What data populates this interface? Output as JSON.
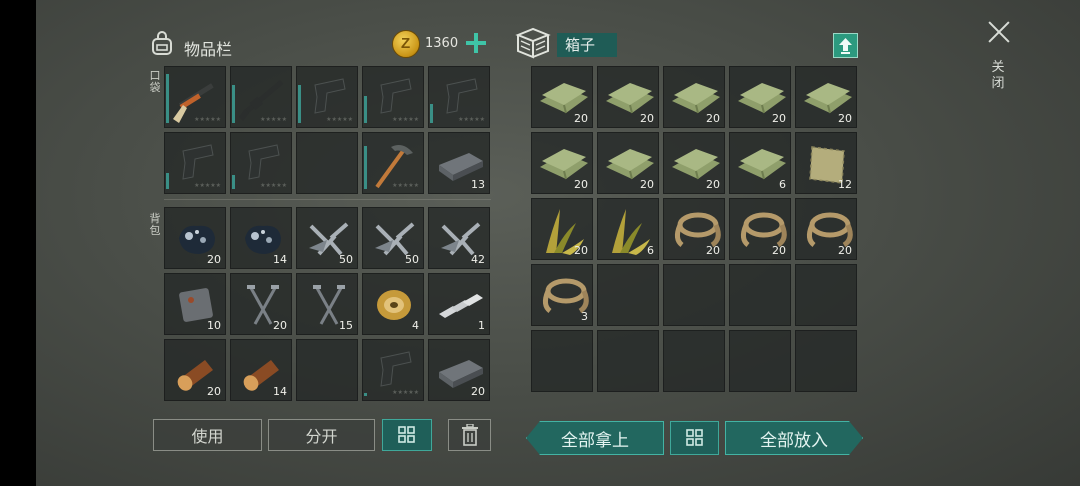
{
  "inventory": {
    "title": "物品栏",
    "coins": "1360",
    "pocket_label": "口袋",
    "backpack_label": "背包"
  },
  "pocket": [
    {
      "icon": "shotgun-icon",
      "count": "",
      "durability": 0.9
    },
    {
      "icon": "assault-rifle-icon",
      "count": "",
      "durability": 0.7
    },
    {
      "icon": "pistol-icon",
      "count": "",
      "durability": 0.7
    },
    {
      "icon": "pistol-icon",
      "count": "",
      "durability": 0.5
    },
    {
      "icon": "pistol-icon",
      "count": "",
      "durability": 0.35
    },
    {
      "icon": "pistol-icon",
      "count": "",
      "durability": 0.3
    },
    {
      "icon": "pistol-icon",
      "count": "",
      "durability": 0.25
    },
    {
      "icon": "empty",
      "count": ""
    },
    {
      "icon": "pickaxe-icon",
      "count": "",
      "durability": 0.8
    },
    {
      "icon": "iron-bar-icon",
      "count": "13"
    }
  ],
  "backpack": [
    {
      "icon": "iron-ore-icon",
      "count": "20"
    },
    {
      "icon": "iron-ore-icon",
      "count": "14"
    },
    {
      "icon": "metal-parts-icon",
      "count": "50"
    },
    {
      "icon": "metal-parts-icon",
      "count": "50"
    },
    {
      "icon": "metal-parts-icon",
      "count": "42"
    },
    {
      "icon": "metal-plate-icon",
      "count": "10"
    },
    {
      "icon": "nails-icon",
      "count": "20"
    },
    {
      "icon": "nails-icon",
      "count": "15"
    },
    {
      "icon": "wire-spool-icon",
      "count": "4"
    },
    {
      "icon": "aluminum-bar-icon",
      "count": "1"
    },
    {
      "icon": "log-icon",
      "count": "20"
    },
    {
      "icon": "log-icon",
      "count": "14"
    },
    {
      "icon": "empty",
      "count": ""
    },
    {
      "icon": "pistol-icon",
      "count": "",
      "durability": 0.05
    },
    {
      "icon": "iron-bar-icon",
      "count": "20"
    }
  ],
  "box": {
    "title": "箱子"
  },
  "box_items": [
    {
      "icon": "cloth-icon",
      "count": "20"
    },
    {
      "icon": "cloth-icon",
      "count": "20"
    },
    {
      "icon": "cloth-icon",
      "count": "20"
    },
    {
      "icon": "cloth-icon",
      "count": "20"
    },
    {
      "icon": "cloth-icon",
      "count": "20"
    },
    {
      "icon": "cloth-icon",
      "count": "20"
    },
    {
      "icon": "cloth-icon",
      "count": "20"
    },
    {
      "icon": "cloth-icon",
      "count": "20"
    },
    {
      "icon": "cloth-icon",
      "count": "6"
    },
    {
      "icon": "rag-icon",
      "count": "12"
    },
    {
      "icon": "plant-fiber-icon",
      "count": "20"
    },
    {
      "icon": "plant-fiber-icon",
      "count": "6"
    },
    {
      "icon": "rope-icon",
      "count": "20"
    },
    {
      "icon": "rope-icon",
      "count": "20"
    },
    {
      "icon": "rope-icon",
      "count": "20"
    },
    {
      "icon": "rope-icon",
      "count": "3"
    },
    {
      "icon": "empty",
      "count": ""
    },
    {
      "icon": "empty",
      "count": ""
    },
    {
      "icon": "empty",
      "count": ""
    },
    {
      "icon": "empty",
      "count": ""
    },
    {
      "icon": "empty",
      "count": ""
    },
    {
      "icon": "empty",
      "count": ""
    },
    {
      "icon": "empty",
      "count": ""
    },
    {
      "icon": "empty",
      "count": ""
    },
    {
      "icon": "empty",
      "count": ""
    }
  ],
  "buttons": {
    "use": "使用",
    "split": "分开",
    "take_all": "全部拿上",
    "put_all": "全部放入"
  },
  "close_label": "关闭",
  "colors": {
    "accent": "#3fc4a7",
    "durability_bar": "#3a8f86",
    "button_teal": "#1f5f59"
  }
}
